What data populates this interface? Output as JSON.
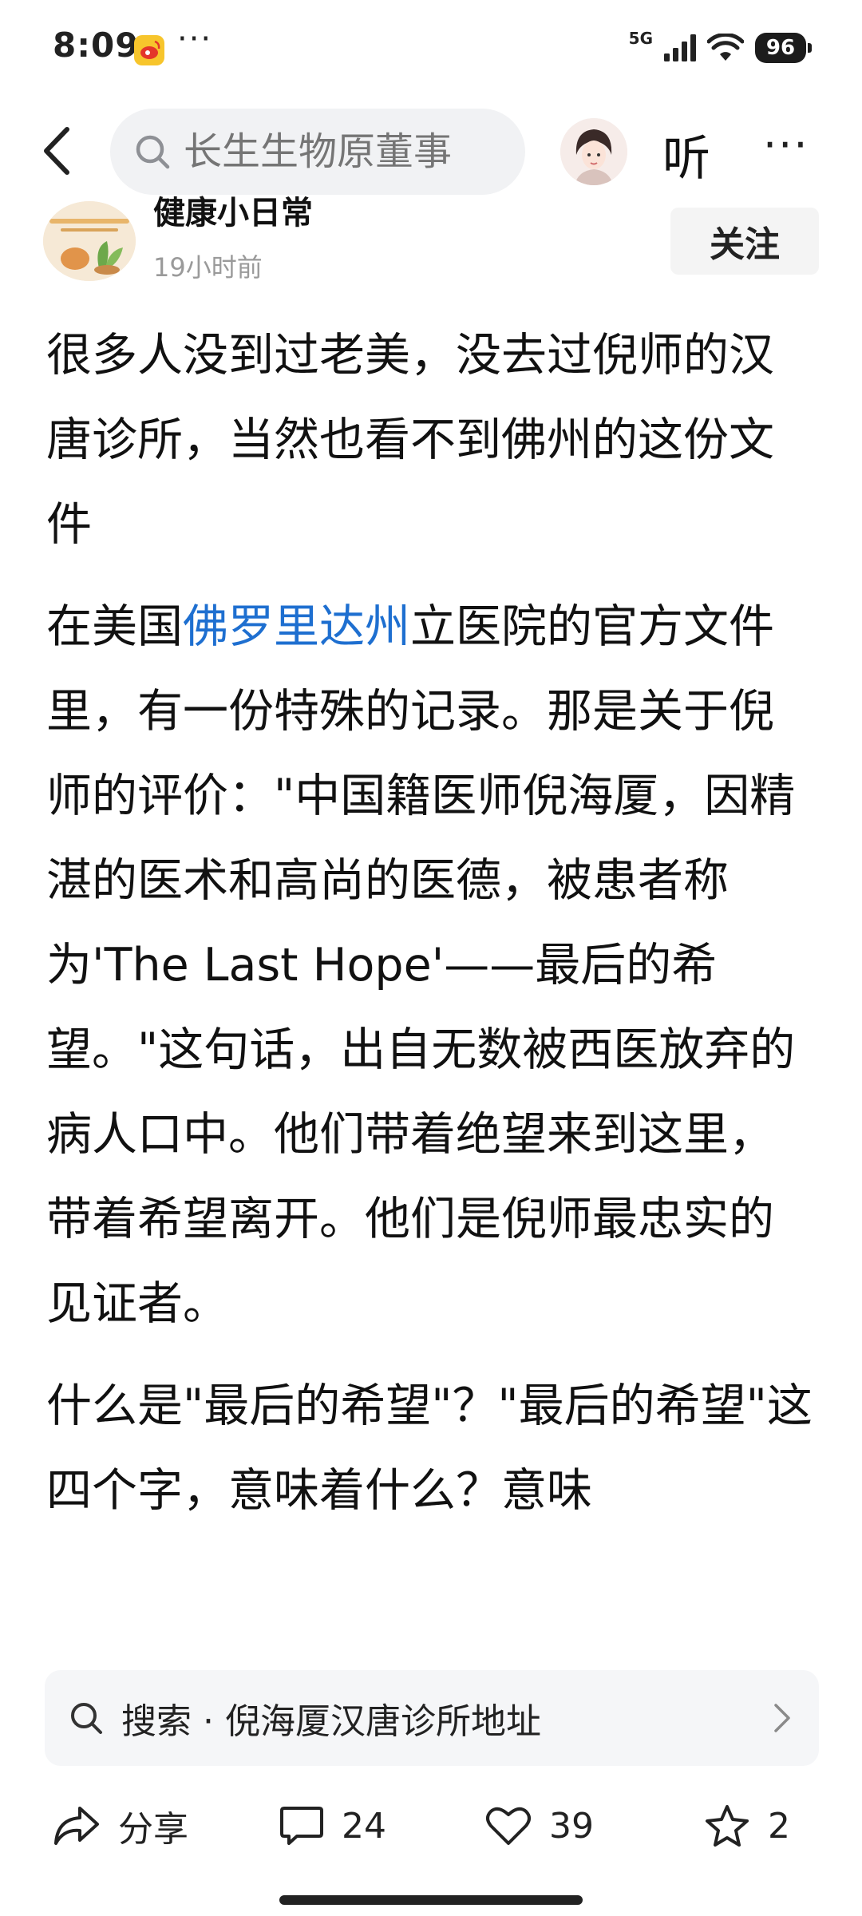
{
  "status_bar": {
    "time": "8:09",
    "dots": "···",
    "network": "5G",
    "battery": "96"
  },
  "nav": {
    "search_placeholder": "长生生物原董事",
    "listen_label": "听",
    "more": "···"
  },
  "author": {
    "name": "健康小日常",
    "time": "19小时前",
    "follow_label": "关注"
  },
  "article": {
    "p1": "很多人没到过老美，没去过倪师的汉唐诊所，当然也看不到佛州的这份文件",
    "p2_before": "在美国",
    "p2_link": "佛罗里达州",
    "p2_after": "立医院的官方文件里，有一份特殊的记录。那是关于倪师的评价：\"中国籍医师倪海厦，因精湛的医术和高尚的医德，被患者称为'The Last Hope'——最后的希望。\"这句话，出自无数被西医放弃的病人口中。他们带着绝望来到这里，带着希望离开。他们是倪师最忠实的见证者。",
    "p3": "什么是\"最后的希望\"？\"最后的希望\"这四个字，意味着什么？意味"
  },
  "related_search": {
    "text": "搜索 · 倪海厦汉唐诊所地址"
  },
  "actions": {
    "share": "分享",
    "comments": "24",
    "likes": "39",
    "favorites": "2"
  },
  "colors": {
    "link": "#1e6fd0",
    "search_bg": "#f1f2f4",
    "muted_text": "#9a9a9a"
  }
}
